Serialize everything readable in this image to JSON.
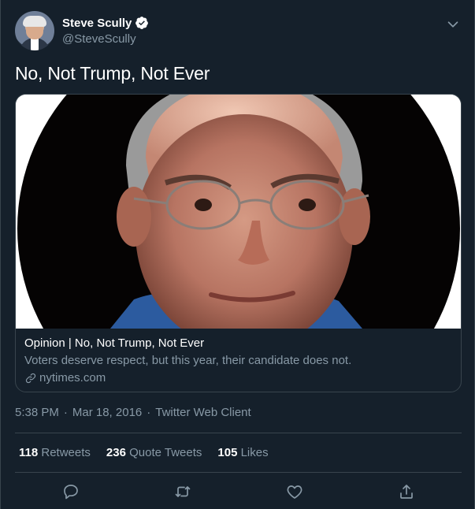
{
  "author": {
    "display_name": "Steve Scully",
    "handle": "@SteveScully"
  },
  "tweet": {
    "text": "No, Not Trump, Not Ever",
    "timestamp": "5:38 PM",
    "date": "Mar 18, 2016",
    "client": "Twitter Web Client",
    "separator": "·"
  },
  "card": {
    "title": "Opinion | No, Not Trump, Not Ever",
    "description": "Voters deserve respect, but this year, their candidate does not.",
    "domain": "nytimes.com"
  },
  "stats": {
    "retweets_count": "118",
    "retweets_label": "Retweets",
    "quotes_count": "236",
    "quotes_label": "Quote Tweets",
    "likes_count": "105",
    "likes_label": "Likes"
  },
  "icons": {
    "verified": "verified-badge-icon",
    "menu": "chevron-down-icon",
    "link": "link-icon",
    "reply": "reply-icon",
    "retweet": "retweet-icon",
    "like": "heart-icon",
    "share": "share-icon"
  },
  "colors": {
    "background": "#15202b",
    "border": "#38444d",
    "secondary_text": "#8899a6",
    "primary_text": "#ffffff"
  }
}
